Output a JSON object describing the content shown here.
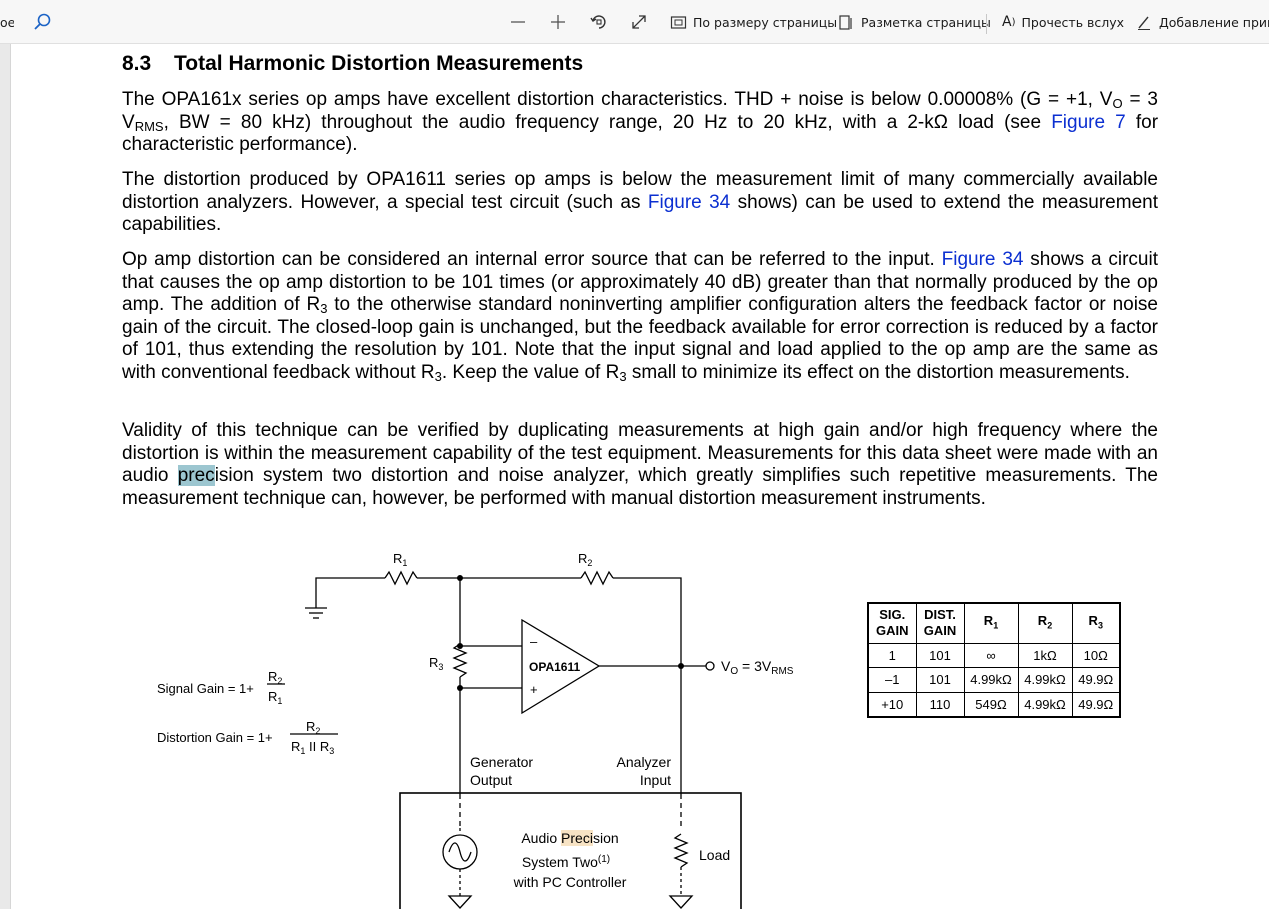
{
  "toolbar": {
    "left_fragment": "oe",
    "fit_page_label": "По размеру страницы",
    "page_layout_label": "Разметка страницы",
    "read_aloud_label": "Прочесть вслух",
    "add_note_label": "Добавление приме",
    "read_aloud_icon_text": "A"
  },
  "document": {
    "section_number": "8.3",
    "section_title": "Total Harmonic Distortion Measurements",
    "p1": {
      "t1": "The OPA161x series op amps have excellent distortion characteristics. THD + noise is below 0.00008% (G = +1, V",
      "sub1": "O",
      "t2": " = 3 V",
      "sub2": "RMS",
      "t3": ", BW = 80 kHz) throughout the audio frequency range, 20 Hz to 20 kHz, with a 2-kΩ load (see ",
      "link1": "Figure 7",
      "t4": " for characteristic performance)."
    },
    "p2": {
      "t1": "The distortion produced by OPA1611 series op amps is below the measurement limit of many commercially available distortion analyzers. However, a special test circuit (such as ",
      "link1": "Figure 34",
      "t2": " shows) can be used to extend the measurement capabilities."
    },
    "p3": {
      "t1": "Op amp distortion can be considered an internal error source that can be referred to the input. ",
      "link1": "Figure 34",
      "t2": " shows a circuit that causes the op amp distortion to be 101 times (or approximately 40 dB) greater than that normally produced by the op amp. The addition of R",
      "sub1": "3",
      "t3": " to the otherwise standard noninverting amplifier configuration alters the feedback factor or noise gain of the circuit. The closed-loop gain is unchanged, but the feedback available for error correction is reduced by a factor of 101, thus extending the resolution by 101. Note that the input signal and load applied to the op amp are the same as with conventional feedback without R",
      "sub2": "3",
      "t4": ". Keep the value of R",
      "sub3": "3",
      "t5": " small to minimize its effect on the distortion measurements."
    },
    "p4": {
      "t1": "Validity of this technique can be verified by duplicating measurements at high gain and/or high frequency where the distortion is within the measurement capability of the test equipment. Measurements for this data sheet were made with an audio ",
      "hl": "prec",
      "t2": "ision system two distortion and noise analyzer, which greatly simplifies such repetitive measurements. The measurement technique can, however, be performed with manual distortion measurement instruments."
    }
  },
  "figure": {
    "r1": "R",
    "r1_sub": "1",
    "r2": "R",
    "r2_sub": "2",
    "r3": "R",
    "r3_sub": "3",
    "opamp": "OPA1611",
    "minus": "–",
    "plus": "+",
    "vout_prefix": "V",
    "vout_sub1": "O",
    "vout_mid": " = 3V",
    "vout_sub2": "RMS",
    "signal_gain": "Signal Gain = 1+",
    "distortion_gain": "Distortion Gain = 1+",
    "frac_num": "R",
    "frac_num_sub": "2",
    "frac_den": "R",
    "frac_den_sub": "1",
    "dist_den": "R",
    "dist_den_sub1": "1",
    "dist_den_mid": " II R",
    "dist_den_sub2": "3",
    "gen_line1": "Generator",
    "gen_line2": "Output",
    "ana_line1": "Analyzer",
    "ana_line2": "Input",
    "ap_line1a": "Audio ",
    "ap_line1b": "Prec",
    "ap_line1c": "ision",
    "ap_line2": "System Two",
    "ap_line2_sup": "(1)",
    "ap_line3": "with PC Controller",
    "load": "Load"
  },
  "table": {
    "headers": [
      {
        "line1": "SIG.",
        "line2": "GAIN"
      },
      {
        "line1": "DIST.",
        "line2": "GAIN"
      },
      {
        "line1": "R",
        "sub": "1"
      },
      {
        "line1": "R",
        "sub": "2"
      },
      {
        "line1": "R",
        "sub": "3"
      }
    ],
    "rows": [
      [
        "1",
        "101",
        "∞",
        "1kΩ",
        "10Ω"
      ],
      [
        "–1",
        "101",
        "4.99kΩ",
        "4.99kΩ",
        "49.9Ω"
      ],
      [
        "+10",
        "110",
        "549Ω",
        "4.99kΩ",
        "49.9Ω"
      ]
    ]
  }
}
